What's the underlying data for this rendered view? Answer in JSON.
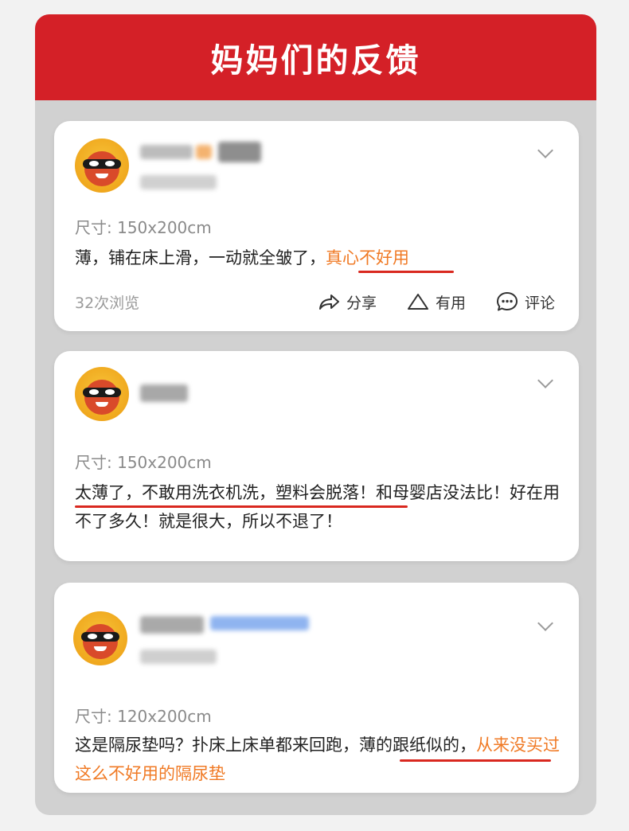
{
  "header": {
    "title": "妈妈们的反馈"
  },
  "colors": {
    "brand_red": "#d42027",
    "highlight_orange": "#f07a25",
    "underline_red": "#d9281f"
  },
  "reviews": [
    {
      "size": "尺寸: 150x200cm",
      "text_plain": "薄，铺在床上滑，一动就全皱了，",
      "text_highlight": "真心不好用",
      "views": "32次浏览",
      "actions": {
        "share": "分享",
        "useful": "有用",
        "comment": "评论"
      }
    },
    {
      "size": "尺寸: 150x200cm",
      "text_plain": "太薄了，不敢用洗衣机洗，塑料会脱落！和母婴店没法比！好在用不了多久！就是很大，所以不退了！"
    },
    {
      "size": "尺寸: 120x200cm",
      "text_plain": "这是隔尿垫吗？扑床上床单都来回跑，薄的跟纸似的，",
      "text_highlight": "从来没买过这么不好用的隔尿垫"
    }
  ]
}
